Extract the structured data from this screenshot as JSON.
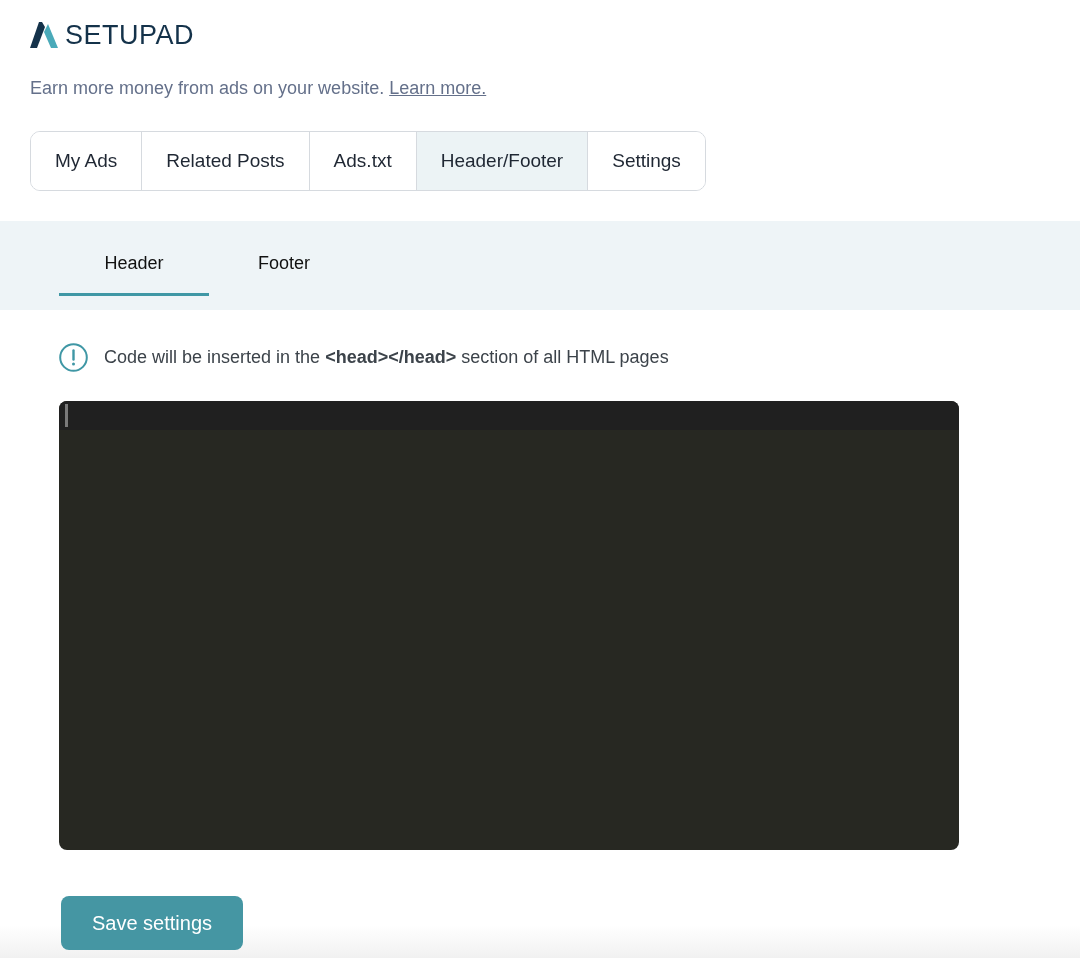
{
  "brand": {
    "name": "SETUPAD"
  },
  "tagline": {
    "text": "Earn more money from ads on your website.",
    "link": "Learn more."
  },
  "tabs": [
    {
      "label": "My Ads",
      "selected": false
    },
    {
      "label": "Related Posts",
      "selected": false
    },
    {
      "label": "Ads.txt",
      "selected": false
    },
    {
      "label": "Header/Footer",
      "selected": true
    },
    {
      "label": "Settings",
      "selected": false
    }
  ],
  "subtabs": [
    {
      "label": "Header",
      "selected": true
    },
    {
      "label": "Footer",
      "selected": false
    }
  ],
  "notice": {
    "text": "Code will be inserted in the **<head></head>** section of all HTML pages"
  },
  "save_button": {
    "label": "Save settings"
  }
}
